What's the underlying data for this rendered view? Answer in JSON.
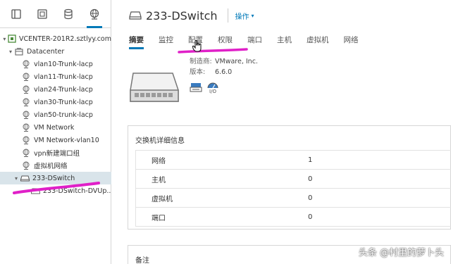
{
  "nav": {
    "tabs": [
      {
        "icon": "hosts-clusters-icon"
      },
      {
        "icon": "vms-templates-icon"
      },
      {
        "icon": "storage-icon"
      },
      {
        "icon": "networking-icon",
        "active": true
      }
    ],
    "tree": [
      {
        "label": "VCENTER-201R2.sztlyy.com",
        "icon": "vcenter-icon",
        "expanded": true
      },
      {
        "label": "Datacenter",
        "icon": "datacenter-icon",
        "expanded": true
      },
      {
        "label": "vlan10-Trunk-lacp",
        "icon": "portgroup-icon"
      },
      {
        "label": "vlan11-Trunk-lacp",
        "icon": "portgroup-icon"
      },
      {
        "label": "vlan24-Trunk-lacp",
        "icon": "portgroup-icon"
      },
      {
        "label": "vlan30-Trunk-lacp",
        "icon": "portgroup-icon"
      },
      {
        "label": "vlan50-trunk-lacp",
        "icon": "portgroup-icon"
      },
      {
        "label": "VM Network",
        "icon": "portgroup-icon"
      },
      {
        "label": "VM Network-vlan10",
        "icon": "portgroup-icon"
      },
      {
        "label": "vpn新建端口组",
        "icon": "portgroup-icon"
      },
      {
        "label": "虚拟机网络",
        "icon": "portgroup-icon"
      },
      {
        "label": "233-DSwitch",
        "icon": "dswitch-icon",
        "expanded": true,
        "selected": true
      },
      {
        "label": "233-DSwitch-DVUp...",
        "icon": "uplink-portgroup-icon"
      }
    ]
  },
  "header": {
    "title": "233-DSwitch",
    "actions_label": "操作",
    "icon": "dswitch-icon"
  },
  "tabs": [
    {
      "label": "摘要",
      "active": true
    },
    {
      "label": "监控"
    },
    {
      "label": "配置"
    },
    {
      "label": "权限"
    },
    {
      "label": "端口"
    },
    {
      "label": "主机"
    },
    {
      "label": "虚拟机"
    },
    {
      "label": "网络"
    }
  ],
  "summary": {
    "manufacturer_key": "制造商:",
    "manufacturer_value": "VMware, Inc.",
    "version_key": "版本:",
    "version_value": "6.6.0",
    "io_label": "I/O"
  },
  "details": {
    "title": "交换机详细信息",
    "rows": [
      {
        "key": "网络",
        "value": "1"
      },
      {
        "key": "主机",
        "value": "0"
      },
      {
        "key": "虚拟机",
        "value": "0"
      },
      {
        "key": "端口",
        "value": "0"
      }
    ]
  },
  "notes": {
    "title": "备注"
  },
  "watermark": "头条 @村里的萝卜头",
  "colors": {
    "accent": "#0079b8",
    "highlight": "#e020c8",
    "selected": "#d9e4ea"
  }
}
